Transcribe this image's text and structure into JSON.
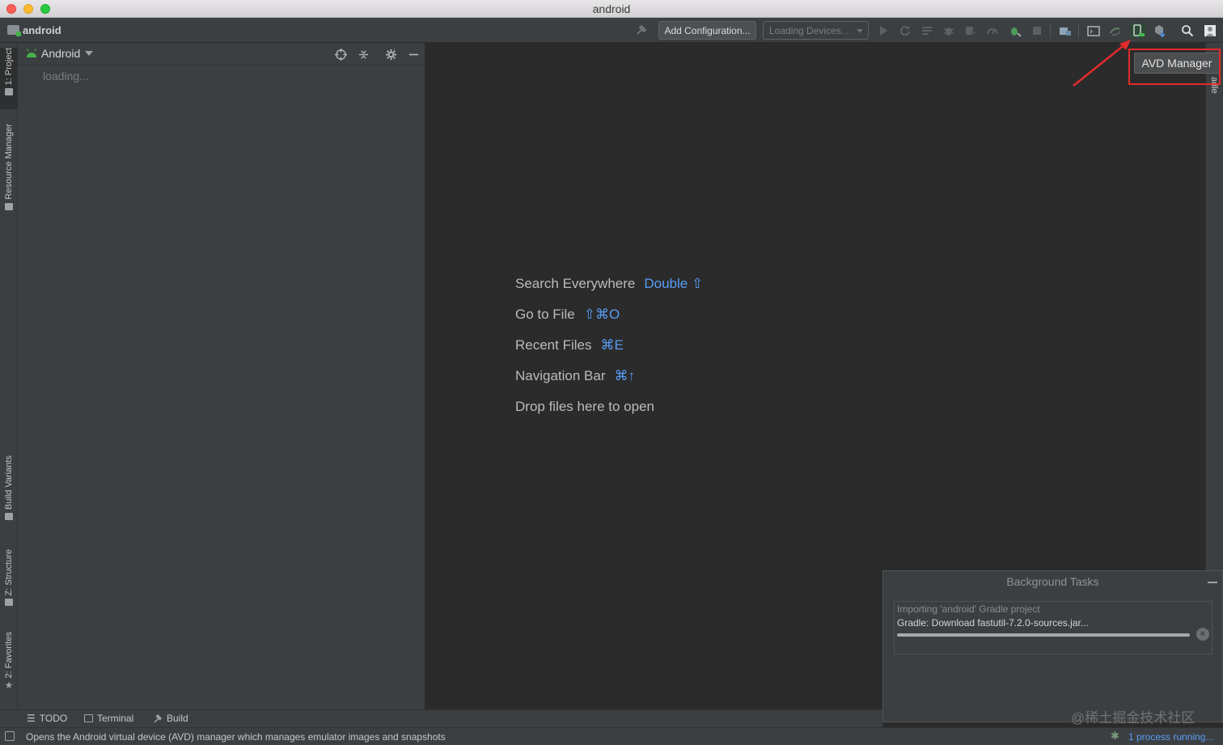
{
  "window": {
    "title": "android"
  },
  "toolbar": {
    "project_name": "android",
    "add_config_label": "Add Configuration...",
    "device_select_value": "Loading Devices..."
  },
  "left_stripe": {
    "tabs": [
      "1: Project",
      "Resource Manager",
      "Build Variants",
      "Z: Structure",
      "2: Favorites"
    ]
  },
  "project_panel": {
    "view_mode": "Android",
    "loading_text": "loading..."
  },
  "editor": {
    "hints": [
      {
        "label": "Search Everywhere",
        "key": "Double ⇧"
      },
      {
        "label": "Go to File",
        "key": "⇧⌘O"
      },
      {
        "label": "Recent Files",
        "key": "⌘E"
      },
      {
        "label": "Navigation Bar",
        "key": "⌘↑"
      },
      {
        "label": "Drop files here to open",
        "key": ""
      }
    ]
  },
  "right_stripe": {
    "label": "adle"
  },
  "tooltip": {
    "text": "AVD Manager"
  },
  "background_tasks": {
    "title": "Background Tasks",
    "task_title": "Importing 'android' Gradle project",
    "task_detail": "Gradle: Download fastutil-7.2.0-sources.jar...",
    "progress": 1.0,
    "watermark": "@稀土掘金技术社区"
  },
  "bottom_tabs": [
    "TODO",
    "Terminal",
    "Build"
  ],
  "status": {
    "message": "Opens the Android virtual device (AVD) manager which manages emulator images and snapshots",
    "process_text": "1 process running..."
  },
  "colors": {
    "accent_blue": "#589df6",
    "annotation_red": "#e22b2b",
    "android_green": "#48b34d"
  }
}
